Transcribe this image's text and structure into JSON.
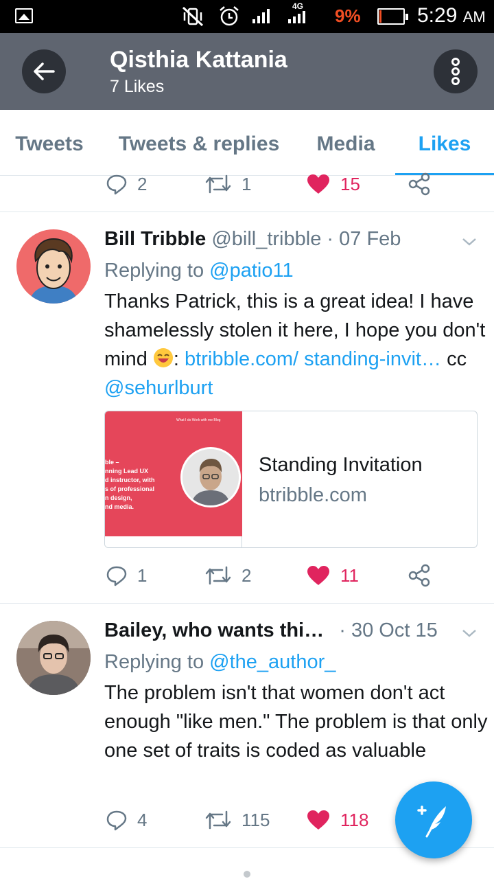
{
  "status_bar": {
    "network": "4G",
    "battery_percent": "9%",
    "battery_level": 0.09,
    "time": "5:29",
    "ampm": "AM"
  },
  "header": {
    "title": "Qisthia Kattania",
    "subtitle": "7 Likes",
    "back_icon": "arrow-left-icon",
    "more_icon": "more-vertical-icon"
  },
  "tabs": [
    {
      "label": "Tweets",
      "active": false
    },
    {
      "label": "Tweets & replies",
      "active": false
    },
    {
      "label": "Media",
      "active": false
    },
    {
      "label": "Likes",
      "active": true
    }
  ],
  "top_actions": {
    "replies": "2",
    "retweets": "1",
    "likes": "15"
  },
  "tweets": [
    {
      "name": "Bill Tribble",
      "handle": "@bill_tribble",
      "separator": "·",
      "date": "07 Feb",
      "replying_prefix": "Replying to",
      "replying_to": "@patio11",
      "text_1": "Thanks Patrick, this is a great idea! I have shamelessly stolen it here, I hope you don't mind",
      "text_2": ":",
      "link": "btribble.com/ standing-invit…",
      "text_3": "cc",
      "mention": "@sehurlburt",
      "card": {
        "title": "Standing Invitation",
        "domain": "btribble.com",
        "image_nav": "What I do    Work with me    Blog",
        "image_lines": [
          "ble –",
          "nning Lead UX",
          "d instructor, with",
          "s of professional",
          "n design,",
          "nd media."
        ]
      },
      "actions": {
        "replies": "1",
        "retweets": "2",
        "likes": "11"
      }
    },
    {
      "name": "Bailey, who wants thi…",
      "separator": "·",
      "date": "30 Oct 15",
      "replying_prefix": "Replying to",
      "replying_to": "@the_author_",
      "text": "The problem isn't that women don't act enough \"like men.\" The problem is that only one set of traits is coded as valuable",
      "actions": {
        "replies": "4",
        "retweets": "115",
        "likes": "118"
      }
    }
  ],
  "accent": "#1da1f2",
  "like_color": "#e0245e",
  "header_color": "#5f6570"
}
